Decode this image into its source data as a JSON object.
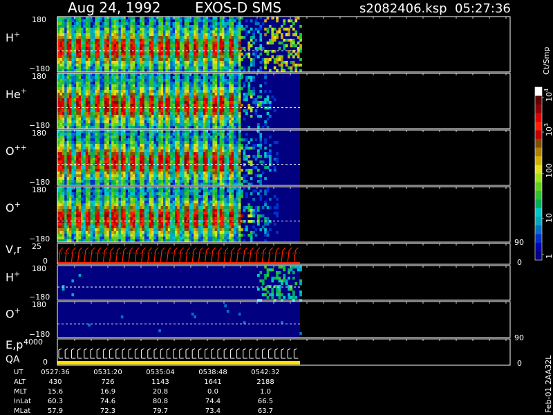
{
  "header": {
    "date": "Aug 24, 1992",
    "instrument": "EXOS-D SMS",
    "file": "s2082406.ksp",
    "time": "05:27:36"
  },
  "colorbar": {
    "unit_label": "Ct/Smp",
    "tick_labels": [
      "1",
      "10",
      "100",
      "10",
      "10"
    ],
    "exponents": [
      "",
      "",
      "",
      "3",
      "4"
    ],
    "colors": [
      "#000080",
      "#0000b4",
      "#0030d0",
      "#0070c8",
      "#00a8c0",
      "#00c8c8",
      "#00b060",
      "#30c030",
      "#60d020",
      "#a0e020",
      "#e0e020",
      "#d0b000",
      "#b08000",
      "#805000",
      "#c00000",
      "#ff2000",
      "#e00000",
      "#900000",
      "#600000",
      "#ffffff"
    ]
  },
  "panels": [
    {
      "id": "hplus",
      "label_base": "H",
      "label_sup": "+",
      "y_top": "180",
      "y_bot": "−180"
    },
    {
      "id": "heplus",
      "label_base": "He",
      "label_sup": "+",
      "y_top": "180",
      "y_bot": "−180"
    },
    {
      "id": "opp",
      "label_base": "O",
      "label_sup": "++",
      "y_top": "180",
      "y_bot": "−180"
    },
    {
      "id": "oplus",
      "label_base": "O",
      "label_sup": "+",
      "y_top": "180",
      "y_bot": "−180"
    },
    {
      "id": "vr",
      "label_base": "V,r",
      "label_sup": "",
      "y_top": "25",
      "y_bot": "0",
      "right_top": "90",
      "right_bot": "0"
    },
    {
      "id": "hplus2",
      "label_base": "H",
      "label_sup": "+",
      "y_top": "180",
      "y_bot": "−180"
    },
    {
      "id": "oplus2",
      "label_base": "O",
      "label_sup": "+",
      "y_top": "180",
      "y_bot": "−180"
    },
    {
      "id": "ep",
      "label_base": "E,p",
      "label_base2": "QA",
      "label_sup": "",
      "y_top": "4000",
      "y_bot": "0",
      "right_top": "90",
      "right_bot": "0"
    }
  ],
  "footer": {
    "row_labels": [
      "UT",
      "ALT",
      "MLT",
      "InLat",
      "MLat"
    ],
    "columns": [
      [
        "0527:36",
        "430",
        "15.6",
        "60.3",
        "57.9"
      ],
      [
        "0531:20",
        "726",
        "16.9",
        "74.6",
        "72.3"
      ],
      [
        "0535:04",
        "1143",
        "20.8",
        "80.8",
        "79.7"
      ],
      [
        "0538:48",
        "1641",
        "0.0",
        "74.4",
        "73.4"
      ],
      [
        "0542:32",
        "2188",
        "1.0",
        "66.5",
        "63.7"
      ]
    ],
    "side_note": "Feb-01 2AA32L"
  },
  "chart_data": {
    "type": "heatmap",
    "title": "Aug 24, 1992   EXOS-D SMS",
    "xlabel": "UT",
    "x_ticks": [
      "0527:36",
      "0531:20",
      "0535:04",
      "0538:48",
      "0542:32"
    ],
    "angle_range": [
      -180,
      180
    ],
    "colorbar_range_ct_per_smp": [
      1,
      10000
    ],
    "colorbar_scale": "log",
    "series": [
      {
        "name": "H+",
        "data_end_fraction": 0.52
      },
      {
        "name": "He+",
        "data_end_fraction": 0.52
      },
      {
        "name": "O++",
        "data_end_fraction": 0.52
      },
      {
        "name": "O+",
        "data_end_fraction": 0.52
      }
    ]
  }
}
